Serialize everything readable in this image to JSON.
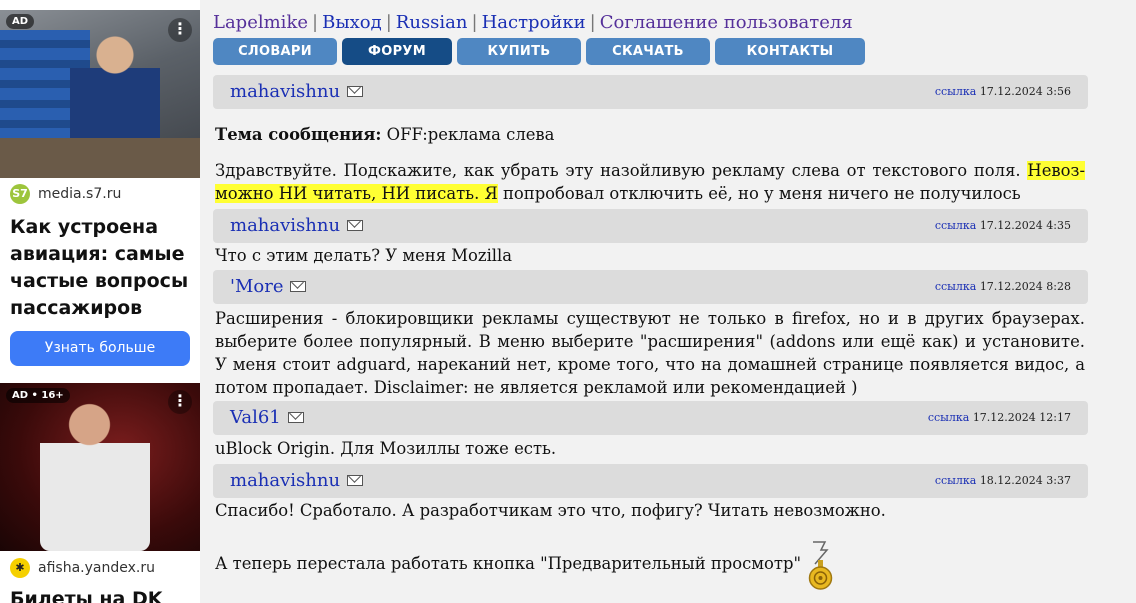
{
  "ads": {
    "ad1": {
      "badge": "AD",
      "source": "media.s7.ru",
      "headline": "Как устроена авиация: самые частые вопросы пассажиров",
      "cta": "Узнать больше",
      "logo_color": "#9dc53c"
    },
    "ad2": {
      "badge": "AD • 16+",
      "source": "afisha.yandex.ru",
      "headline": "Билеты на DK",
      "logo_color": "#f5d000"
    },
    "menu_glyph": "⋮"
  },
  "topnav": {
    "user": "Lapelmike",
    "logout": "Выход",
    "language": "Russian",
    "settings": "Настройки",
    "agreement": "Соглашение пользователя",
    "separator": "|"
  },
  "menu": {
    "dictionaries": "СЛОВАРИ",
    "forum": "ФОРУМ",
    "buy": "КУПИТЬ",
    "download": "СКАЧАТЬ",
    "contacts": "КОНТАКТЫ"
  },
  "link_label": "ссылка",
  "topic": {
    "label": "Тема сообщения:",
    "value": "OFF:реклама слева"
  },
  "posts": [
    {
      "author": "mahavishnu",
      "date": "17.12.2024 3:56",
      "text_before": "Здравствуйте. Подскажите, как убрать эту назойливую рекламу слева от текстового поля. ",
      "text_highlight": "Невоз­можно НИ читать, НИ писать. Я",
      "text_after": " попробовал отключить её, но у меня ничего не получилось"
    },
    {
      "author": "mahavishnu",
      "date": "17.12.2024 4:35",
      "text": "Что с этим делать? У меня Mozilla"
    },
    {
      "author": "'More",
      "date": "17.12.2024 8:28",
      "text": "Расширения - блокировщики рекламы существуют не только в firefox, но и в других браузерах. выбе­рите более популярный. В меню выберите \"расширения\" (addons или ещё как) и установите. У меня стоит adguard, нареканий нет, кроме того, что на домашней странице появляется видос, а потом про­падает. Disclaimer: не является рекламой или рекомендацией )"
    },
    {
      "author": "Val61",
      "date": "17.12.2024 12:17",
      "text": "uBlock Origin. Для Мозиллы тоже есть."
    },
    {
      "author": "mahavishnu",
      "date": "18.12.2024 3:37",
      "text": "Спасибо! Сработало. А разработчикам это что, пофигу? Читать невозможно.",
      "text2": "А теперь перестала работать кнопка \"Предварительный просмотр\""
    }
  ],
  "colors": {
    "link": "#1a2fb4",
    "menu_button": "#4f87c2",
    "menu_button_active": "#154c86",
    "post_header": "#dcdcdc",
    "highlight": "#ffff33"
  }
}
